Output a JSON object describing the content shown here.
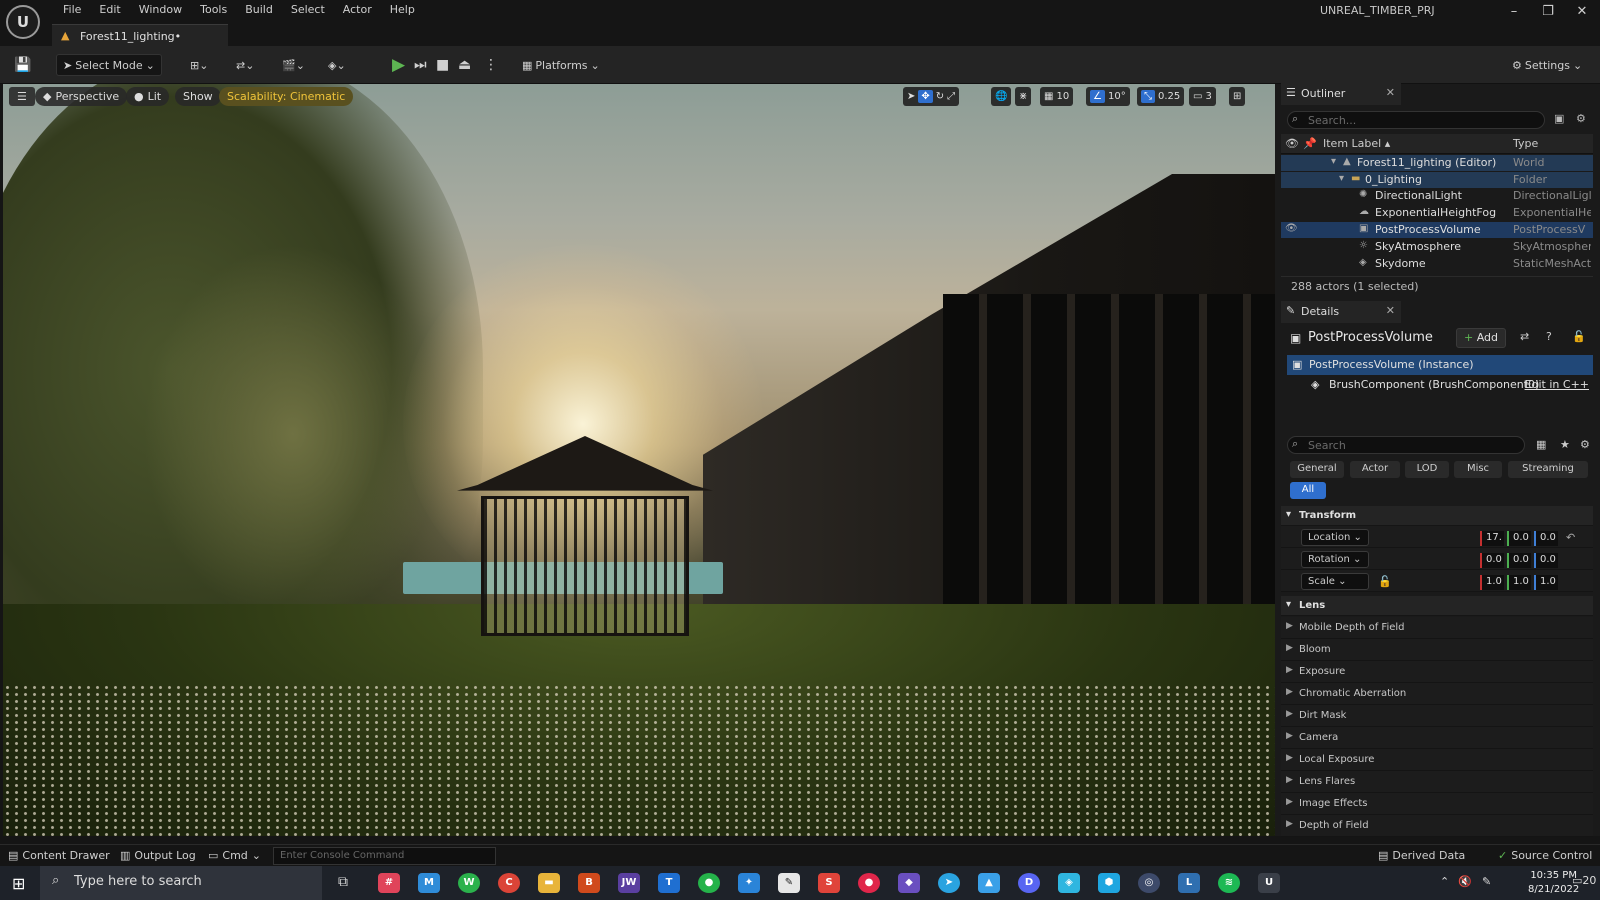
{
  "menu": {
    "items": [
      "File",
      "Edit",
      "Window",
      "Tools",
      "Build",
      "Select",
      "Actor",
      "Help"
    ],
    "project": "UNREAL_TIMBER_PRJ"
  },
  "doc_tab": {
    "label": "Forest11_lighting•"
  },
  "toolbar": {
    "select_mode": "Select Mode",
    "platforms": "Platforms",
    "settings": "Settings"
  },
  "viewport": {
    "perspective": "Perspective",
    "lit": "Lit",
    "show": "Show",
    "scalability": "Scalability: Cinematic",
    "grid_snap": "10",
    "rot_snap": "10°",
    "scale_snap": "0.25",
    "cam_speed": "3"
  },
  "outliner": {
    "title": "Outliner",
    "search_placeholder": "Search...",
    "col_label": "Item Label",
    "col_type": "Type",
    "rows": [
      {
        "label": "Forest11_lighting (Editor)",
        "type": "World"
      },
      {
        "label": "0_Lighting",
        "type": "Folder"
      },
      {
        "label": "DirectionalLight",
        "type": "DirectionalLigl"
      },
      {
        "label": "ExponentialHeightFog",
        "type": "ExponentialHe"
      },
      {
        "label": "PostProcessVolume",
        "type": "PostProcessV"
      },
      {
        "label": "SkyAtmosphere",
        "type": "SkyAtmospher"
      },
      {
        "label": "Skydome",
        "type": "StaticMeshAct"
      }
    ],
    "count": "288 actors (1 selected)"
  },
  "details": {
    "title": "Details",
    "actor": "PostProcessVolume",
    "add": "Add",
    "instance": "PostProcessVolume (Instance)",
    "component": "BrushComponent (BrushComponent0)",
    "edit_cpp": "Edit in C++",
    "search_placeholder": "Search",
    "filters": [
      "General",
      "Actor",
      "LOD",
      "Misc",
      "Streaming"
    ],
    "filter_all": "All",
    "transform": "Transform",
    "location": {
      "label": "Location",
      "x": "17.",
      "y": "0.0",
      "z": "0.0"
    },
    "rotation": {
      "label": "Rotation",
      "x": "0.0",
      "y": "0.0",
      "z": "0.0"
    },
    "scale": {
      "label": "Scale",
      "x": "1.0",
      "y": "1.0",
      "z": "1.0"
    },
    "lens": "Lens",
    "lens_items": [
      "Mobile Depth of Field",
      "Bloom",
      "Exposure",
      "Chromatic Aberration",
      "Dirt Mask",
      "Camera",
      "Local Exposure",
      "Lens Flares",
      "Image Effects",
      "Depth of Field"
    ]
  },
  "bottom": {
    "content_drawer": "Content Drawer",
    "output_log": "Output Log",
    "cmd": "Cmd",
    "console_placeholder": "Enter Console Command",
    "derived_data": "Derived Data",
    "source_control": "Source Control"
  },
  "taskbar": {
    "search": "Type here to search",
    "time": "10:35 PM",
    "date": "8/21/2022",
    "notif": "20"
  }
}
